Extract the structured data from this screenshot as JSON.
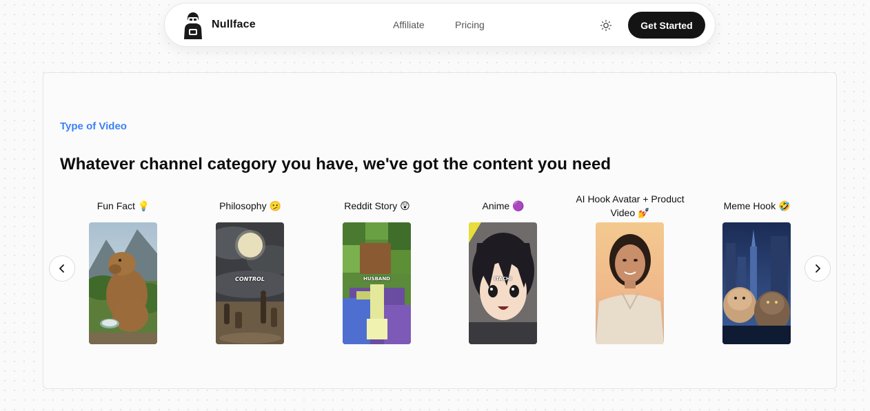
{
  "navbar": {
    "brand": "Nullface",
    "links": [
      "Affiliate",
      "Pricing"
    ],
    "cta_label": "Get Started",
    "icons": {
      "logo": "masked-figure-logo",
      "theme": "sun-icon"
    }
  },
  "section": {
    "eyebrow": "Type of Video",
    "heading": "Whatever channel category you have, we've got the content you need"
  },
  "carousel": {
    "prev_icon": "chevron-left-icon",
    "next_icon": "chevron-right-icon",
    "items": [
      {
        "title": "Fun Fact",
        "emoji": "💡",
        "caption": ""
      },
      {
        "title": "Philosophy",
        "emoji": "🫤",
        "caption": "CONTROL"
      },
      {
        "title": "Reddit Story",
        "emoji": "😲",
        "caption": "HUSBAND"
      },
      {
        "title": "Anime",
        "emoji": "🟣",
        "caption": "ITACHI"
      },
      {
        "title": "AI Hook Avatar + Product Video",
        "emoji": "💅",
        "caption": ""
      },
      {
        "title": "Meme Hook",
        "emoji": "🤣",
        "caption": ""
      }
    ]
  },
  "colors": {
    "accent": "#3b82f6",
    "cta_bg": "#141414"
  }
}
